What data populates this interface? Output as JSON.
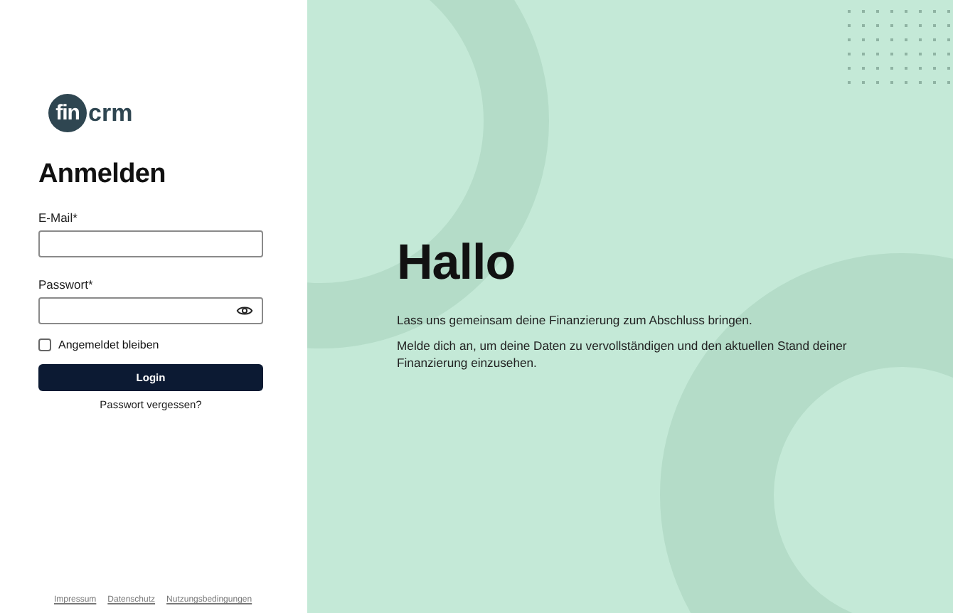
{
  "logo": {
    "mark_text": "fin",
    "text": "crm"
  },
  "heading": "Anmelden",
  "fields": [
    {
      "label": "E-Mail*",
      "kind": "text"
    },
    {
      "label": "Passwort*",
      "kind": "password"
    }
  ],
  "remember": {
    "label": "Angemeldet bleiben",
    "checked": false
  },
  "login_button": "Login",
  "forgot_link": "Passwort vergessen?",
  "footer_links": [
    "Impressum",
    "Datenschutz",
    "Nutzungsbedingungen"
  ],
  "hero": {
    "title": "Hallo",
    "paragraphs": [
      "Lass uns gemeinsam deine Finanzierung zum Abschluss bringen.",
      "Melde dich an, um deine Daten zu vervollständigen und den aktuellen Stand deiner Finanzierung einzusehen."
    ]
  }
}
